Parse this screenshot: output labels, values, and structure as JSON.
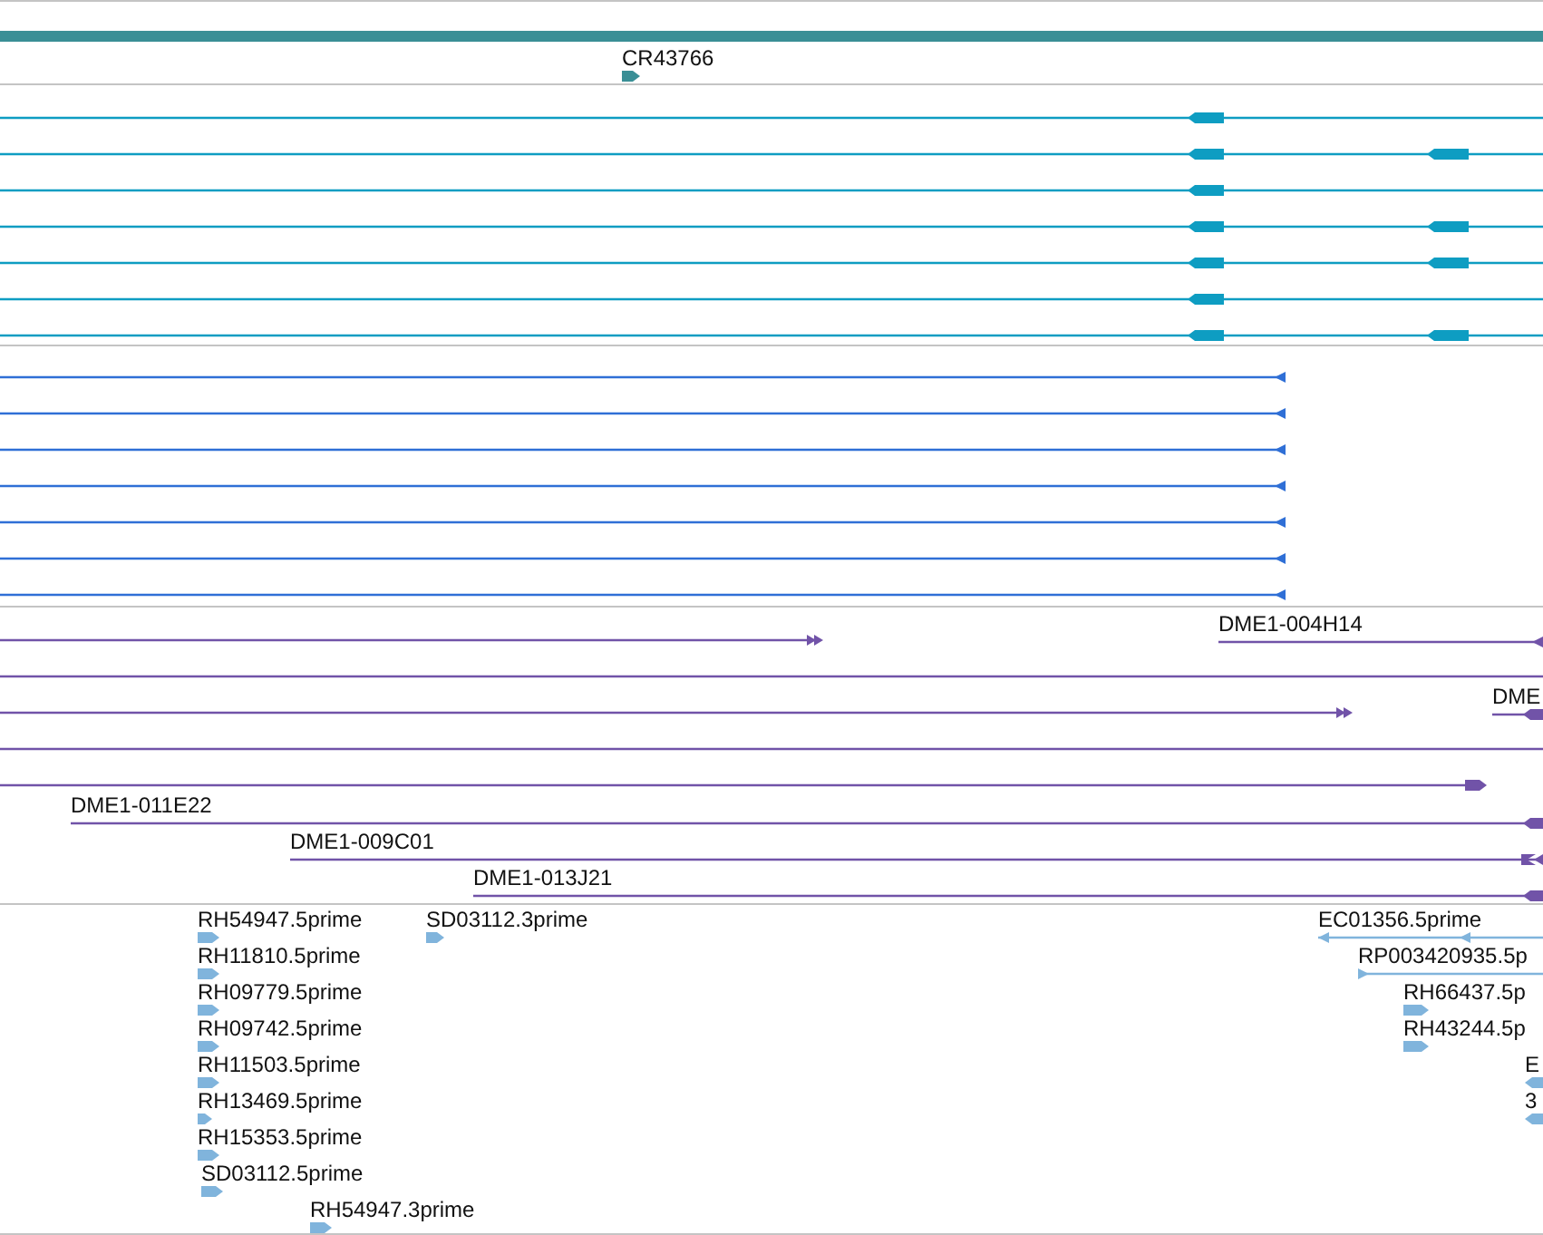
{
  "tracks": [
    {
      "kind": "gene",
      "features": [
        {
          "label": "CR43766",
          "reverse": false
        }
      ]
    },
    {
      "kind": "exon_rows"
    },
    {
      "kind": "transcript_rows"
    },
    {
      "kind": "clones",
      "features": [
        {
          "label": "DME1-004H14",
          "reverse": true
        },
        {
          "label": "DME",
          "reverse": true
        },
        {
          "label": "DME1-011E22",
          "reverse": true
        },
        {
          "label": "DME1-009C01",
          "reverse": true
        },
        {
          "label": "DME1-013J21",
          "reverse": true
        }
      ]
    },
    {
      "kind": "ests",
      "features": [
        {
          "label": "RH54947.5prime",
          "reverse": false
        },
        {
          "label": "SD03112.3prime",
          "reverse": false
        },
        {
          "label": "RH11810.5prime",
          "reverse": false
        },
        {
          "label": "RH09779.5prime",
          "reverse": false
        },
        {
          "label": "RH09742.5prime",
          "reverse": false
        },
        {
          "label": "RH11503.5prime",
          "reverse": false
        },
        {
          "label": "RH13469.5prime",
          "reverse": false
        },
        {
          "label": "RH15353.5prime",
          "reverse": false
        },
        {
          "label": "SD03112.5prime",
          "reverse": false
        },
        {
          "label": "RH54947.3prime",
          "reverse": false
        },
        {
          "label": "EC01356.5prime",
          "reverse": true
        },
        {
          "label": "RP003420935.5p",
          "reverse": false
        },
        {
          "label": "RH66437.5p",
          "reverse": false
        },
        {
          "label": "RH43244.5p",
          "reverse": false
        },
        {
          "label": "E",
          "reverse": true
        },
        {
          "label": "3",
          "reverse": true
        }
      ]
    }
  ]
}
